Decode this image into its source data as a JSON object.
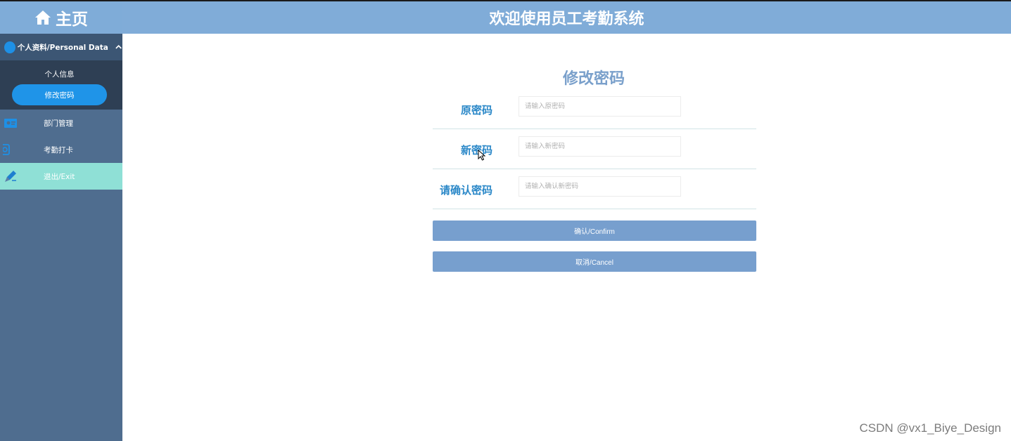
{
  "sidebar": {
    "home_label": "主页",
    "section": {
      "label": "个人资料/Personal Data",
      "items": [
        {
          "label": "个人信息"
        },
        {
          "label": "修改密码"
        }
      ]
    },
    "items": [
      {
        "label": "部门管理",
        "icon": "id-card-icon"
      },
      {
        "label": "考勤打卡",
        "icon": "checkin-icon"
      },
      {
        "label": "退出/Exit",
        "icon": "pencil-icon"
      }
    ]
  },
  "header": {
    "title": "欢迎使用员工考勤系统"
  },
  "form": {
    "title": "修改密码",
    "fields": [
      {
        "label": "原密码",
        "placeholder": "请输入原密码",
        "value": ""
      },
      {
        "label": "新密码",
        "placeholder": "请输入新密码",
        "value": ""
      },
      {
        "label": "请确认密码",
        "placeholder": "请输入确认新密码",
        "value": ""
      }
    ],
    "confirm_label": "确认/Confirm",
    "cancel_label": "取消/Cancel"
  },
  "watermark": "CSDN @vx1_Biye_Design",
  "colors": {
    "header": "#80acd8",
    "sidebar": "#4f6d8f",
    "active_pill": "#1f94e8",
    "exit_item": "#8fe0d6",
    "label_blue": "#2b88c8",
    "button": "#779fce"
  }
}
